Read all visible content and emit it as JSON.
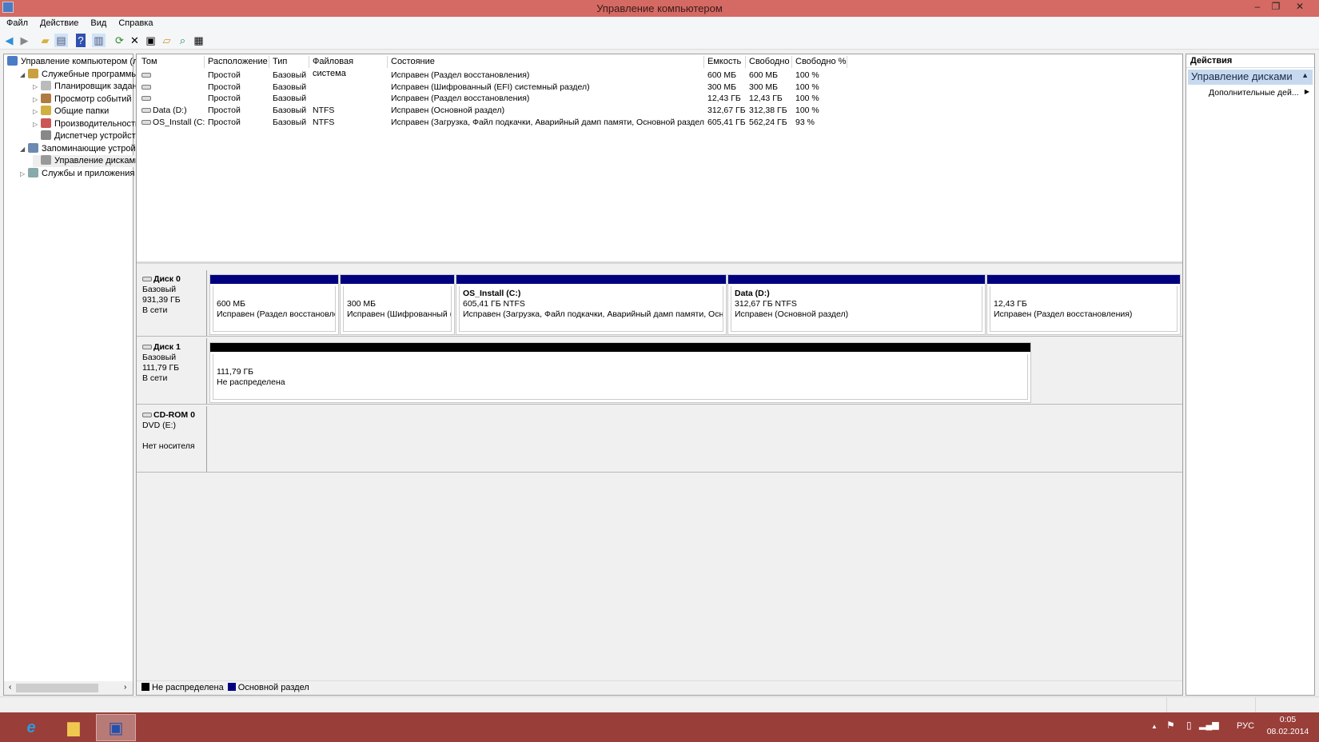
{
  "window": {
    "title": "Управление компьютером",
    "minimize": "–",
    "restore": "❐",
    "close": "✕"
  },
  "menu": [
    "Файл",
    "Действие",
    "Вид",
    "Справка"
  ],
  "toolbar": [
    "back-icon",
    "forward-icon",
    "up-folder-icon",
    "show-tree-icon",
    "help-icon",
    "show-actions-icon",
    "refresh-icon",
    "delete-icon",
    "properties-icon",
    "open-icon",
    "search-icon",
    "rescan-icon"
  ],
  "tree": [
    {
      "label": "Управление компьютером (л",
      "level": 0,
      "expand": ""
    },
    {
      "label": "Служебные программы",
      "level": 1,
      "expand": "◢"
    },
    {
      "label": "Планировщик заданий",
      "level": 2,
      "expand": "▷"
    },
    {
      "label": "Просмотр событий",
      "level": 2,
      "expand": "▷"
    },
    {
      "label": "Общие папки",
      "level": 2,
      "expand": "▷"
    },
    {
      "label": "Производительность",
      "level": 2,
      "expand": "▷"
    },
    {
      "label": "Диспетчер устройств",
      "level": 2,
      "expand": ""
    },
    {
      "label": "Запоминающие устройст",
      "level": 1,
      "expand": "◢"
    },
    {
      "label": "Управление дисками",
      "level": 2,
      "expand": ""
    },
    {
      "label": "Службы и приложения",
      "level": 1,
      "expand": "▷"
    }
  ],
  "volumes": {
    "columns": [
      "Том",
      "Расположение",
      "Тип",
      "Файловая система",
      "Состояние",
      "Емкость",
      "Свободно",
      "Свободно %"
    ],
    "rows": [
      [
        "",
        "Простой",
        "Базовый",
        "",
        "Исправен (Раздел восстановления)",
        "600 МБ",
        "600 МБ",
        "100 %"
      ],
      [
        "",
        "Простой",
        "Базовый",
        "",
        "Исправен (Шифрованный (EFI) системный раздел)",
        "300 МБ",
        "300 МБ",
        "100 %"
      ],
      [
        "",
        "Простой",
        "Базовый",
        "",
        "Исправен (Раздел восстановления)",
        "12,43 ГБ",
        "12,43 ГБ",
        "100 %"
      ],
      [
        "Data (D:)",
        "Простой",
        "Базовый",
        "NTFS",
        "Исправен (Основной раздел)",
        "312,67 ГБ",
        "312,38 ГБ",
        "100 %"
      ],
      [
        "OS_Install (C:)",
        "Простой",
        "Базовый",
        "NTFS",
        "Исправен (Загрузка, Файл подкачки, Аварийный дамп памяти, Основной раздел)",
        "605,41 ГБ",
        "562,24 ГБ",
        "93 %"
      ]
    ]
  },
  "disks": [
    {
      "name": "Диск 0",
      "type": "Базовый",
      "size": "931,39 ГБ",
      "status": "В сети",
      "partitions": [
        {
          "title": "",
          "size": "600 МБ",
          "state": "Исправен (Раздел восстановления)"
        },
        {
          "title": "",
          "size": "300 МБ",
          "state": "Исправен (Шифрованный (EFI) системный раздел)"
        },
        {
          "title": "OS_Install  (C:)",
          "size": "605,41 ГБ NTFS",
          "state": "Исправен (Загрузка, Файл подкачки, Аварийный дамп памяти, Основной раздел)"
        },
        {
          "title": "Data  (D:)",
          "size": "312,67 ГБ NTFS",
          "state": "Исправен (Основной раздел)"
        },
        {
          "title": "",
          "size": "12,43 ГБ",
          "state": "Исправен (Раздел восстановления)"
        }
      ]
    },
    {
      "name": "Диск 1",
      "type": "Базовый",
      "size": "111,79 ГБ",
      "status": "В сети",
      "partitions": [
        {
          "title": "",
          "size": "111,79 ГБ",
          "state": "Не распределена"
        }
      ]
    },
    {
      "name": "CD-ROM 0",
      "type": "DVD (E:)",
      "size": "",
      "status": "Нет носителя"
    }
  ],
  "legend": [
    {
      "label": "Не распределена",
      "color": "#000000"
    },
    {
      "label": "Основной раздел",
      "color": "#00007f"
    }
  ],
  "actions": {
    "header": "Действия",
    "section": "Управление дисками",
    "item": "Дополнительные дей..."
  },
  "tray": {
    "lang": "РУС",
    "time": "0:05",
    "date": "08.02.2014"
  },
  "colors": {
    "primary_partition": "#00007f",
    "unallocated": "#000000",
    "titlebar": "#d46a63",
    "taskbar": "#993e39"
  }
}
